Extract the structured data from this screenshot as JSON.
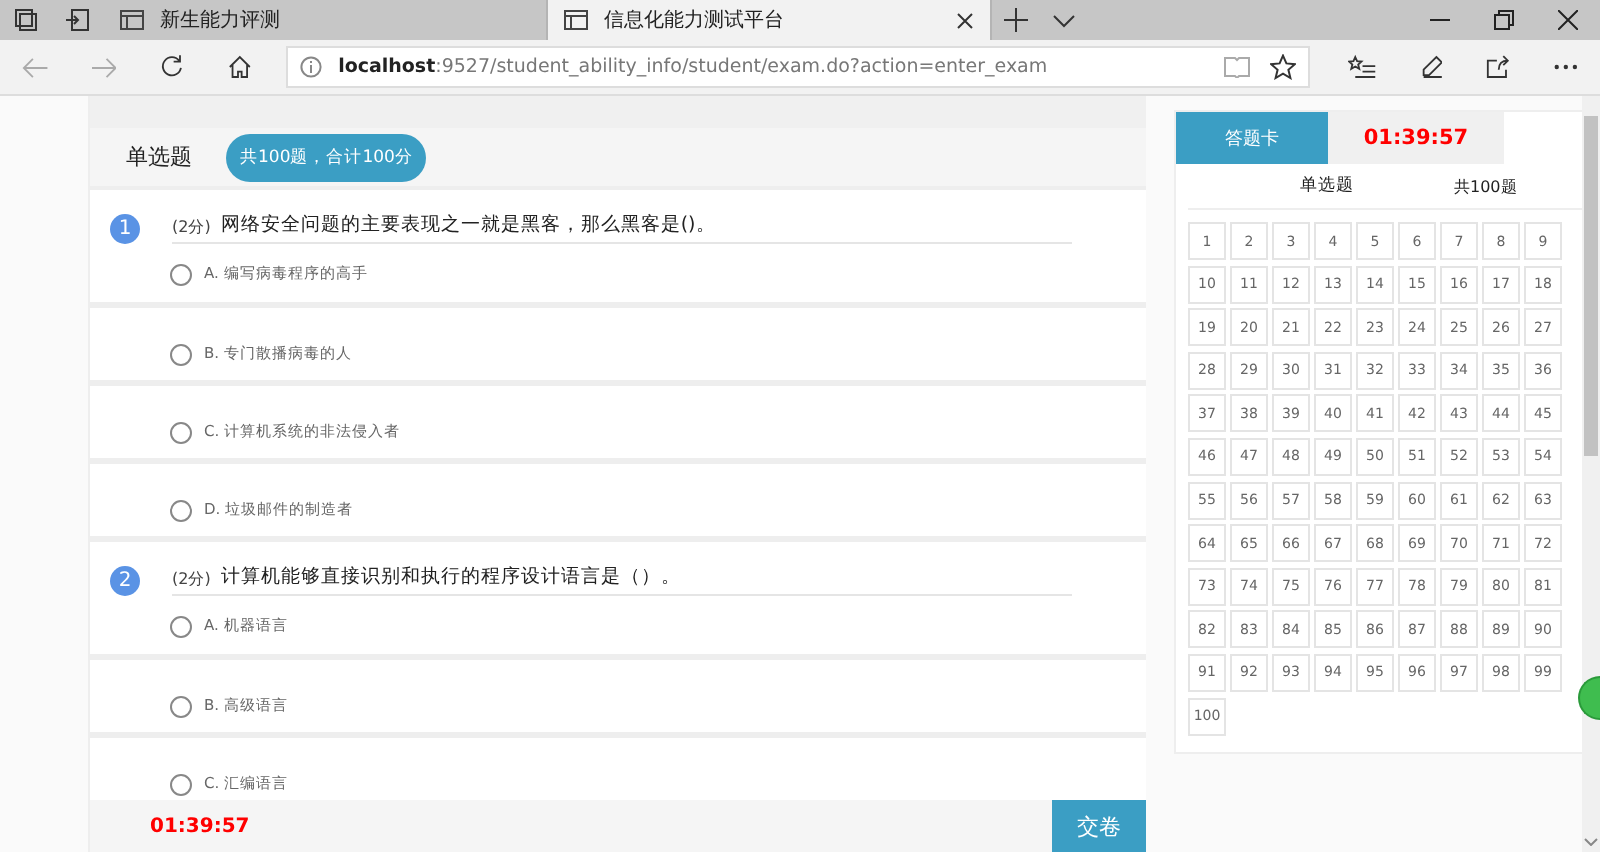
{
  "browser": {
    "tabs": [
      {
        "title": "新生能力评测",
        "selected": false
      },
      {
        "title": "信息化能力测试平台",
        "selected": true
      }
    ],
    "url_host": "localhost",
    "url_rest": ":9527/student_ability_info/student/exam.do?action=enter_exam"
  },
  "exam": {
    "section_title": "单选题",
    "summary_badge": "共100题，合计100分",
    "questions": [
      {
        "number": "1",
        "points": "(2分)",
        "text": "网络安全问题的主要表现之一就是黑客，那么黑客是()。",
        "options": [
          {
            "label": "A. 编写病毒程序的高手",
            "selected": false
          },
          {
            "label": "B. 专门散播病毒的人",
            "selected": false
          },
          {
            "label": "C. 计算机系统的非法侵入者",
            "selected": false
          },
          {
            "label": "D. 垃圾邮件的制造者",
            "selected": false
          }
        ]
      },
      {
        "number": "2",
        "points": "(2分)",
        "text": "计算机能够直接识别和执行的程序设计语言是（）。",
        "options": [
          {
            "label": "A. 机器语言",
            "selected": false
          },
          {
            "label": "B. 高级语言",
            "selected": false
          },
          {
            "label": "C. 汇编语言",
            "selected": false
          }
        ]
      }
    ]
  },
  "footer": {
    "timer": "01:39:57",
    "submit_button": "交卷"
  },
  "answer_card": {
    "tab_label": "答题卡",
    "timer": "01:39:57",
    "section": "单选题",
    "count": "共100题",
    "numbers": [
      "1",
      "2",
      "3",
      "4",
      "5",
      "6",
      "7",
      "8",
      "9",
      "10",
      "11",
      "12",
      "13",
      "14",
      "15",
      "16",
      "17",
      "18",
      "19",
      "20",
      "21",
      "22",
      "23",
      "24",
      "25",
      "26",
      "27",
      "28",
      "29",
      "30",
      "31",
      "32",
      "33",
      "34",
      "35",
      "36",
      "37",
      "38",
      "39",
      "40",
      "41",
      "42",
      "43",
      "44",
      "45",
      "46",
      "47",
      "48",
      "49",
      "50",
      "51",
      "52",
      "53",
      "54",
      "55",
      "56",
      "57",
      "58",
      "59",
      "60",
      "61",
      "62",
      "63",
      "64",
      "65",
      "66",
      "67",
      "68",
      "69",
      "70",
      "71",
      "72",
      "73",
      "74",
      "75",
      "76",
      "77",
      "78",
      "79",
      "80",
      "81",
      "82",
      "83",
      "84",
      "85",
      "86",
      "87",
      "88",
      "89",
      "90",
      "91",
      "92",
      "93",
      "94",
      "95",
      "96",
      "97",
      "98",
      "99",
      "100"
    ]
  }
}
